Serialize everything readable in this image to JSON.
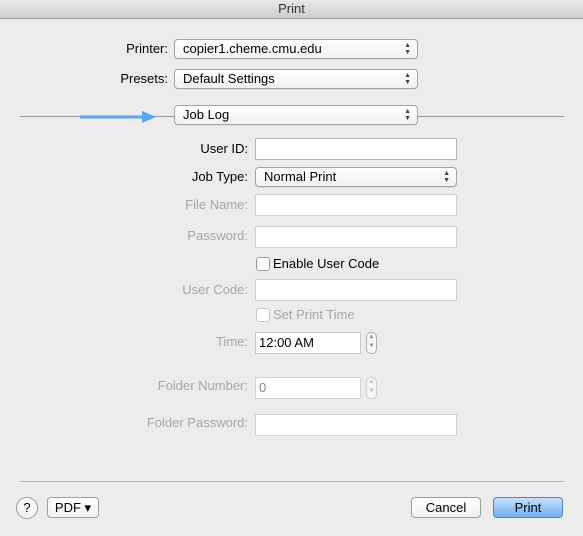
{
  "window": {
    "title": "Print"
  },
  "printer": {
    "label": "Printer:",
    "value": "copier1.cheme.cmu.edu"
  },
  "presets": {
    "label": "Presets:",
    "value": "Default Settings"
  },
  "panel": {
    "value": "Job Log"
  },
  "accent": "#5aa9ee",
  "form": {
    "user_id": {
      "label": "User ID:",
      "value": ""
    },
    "job_type": {
      "label": "Job Type:",
      "value": "Normal Print"
    },
    "file_name": {
      "label": "File Name:",
      "value": ""
    },
    "password": {
      "label": "Password:",
      "value": ""
    },
    "enable_user_code": {
      "label": "Enable User Code",
      "checked": false
    },
    "user_code": {
      "label": "User Code:",
      "value": ""
    },
    "set_print_time": {
      "label": "Set Print Time",
      "checked": false
    },
    "time": {
      "label": "Time:",
      "value": "12:00 AM"
    },
    "folder_number": {
      "label": "Folder Number:",
      "value": "0"
    },
    "folder_password": {
      "label": "Folder Password:",
      "value": ""
    }
  },
  "footer": {
    "help": "?",
    "pdf": "PDF ▾",
    "cancel": "Cancel",
    "print": "Print"
  }
}
